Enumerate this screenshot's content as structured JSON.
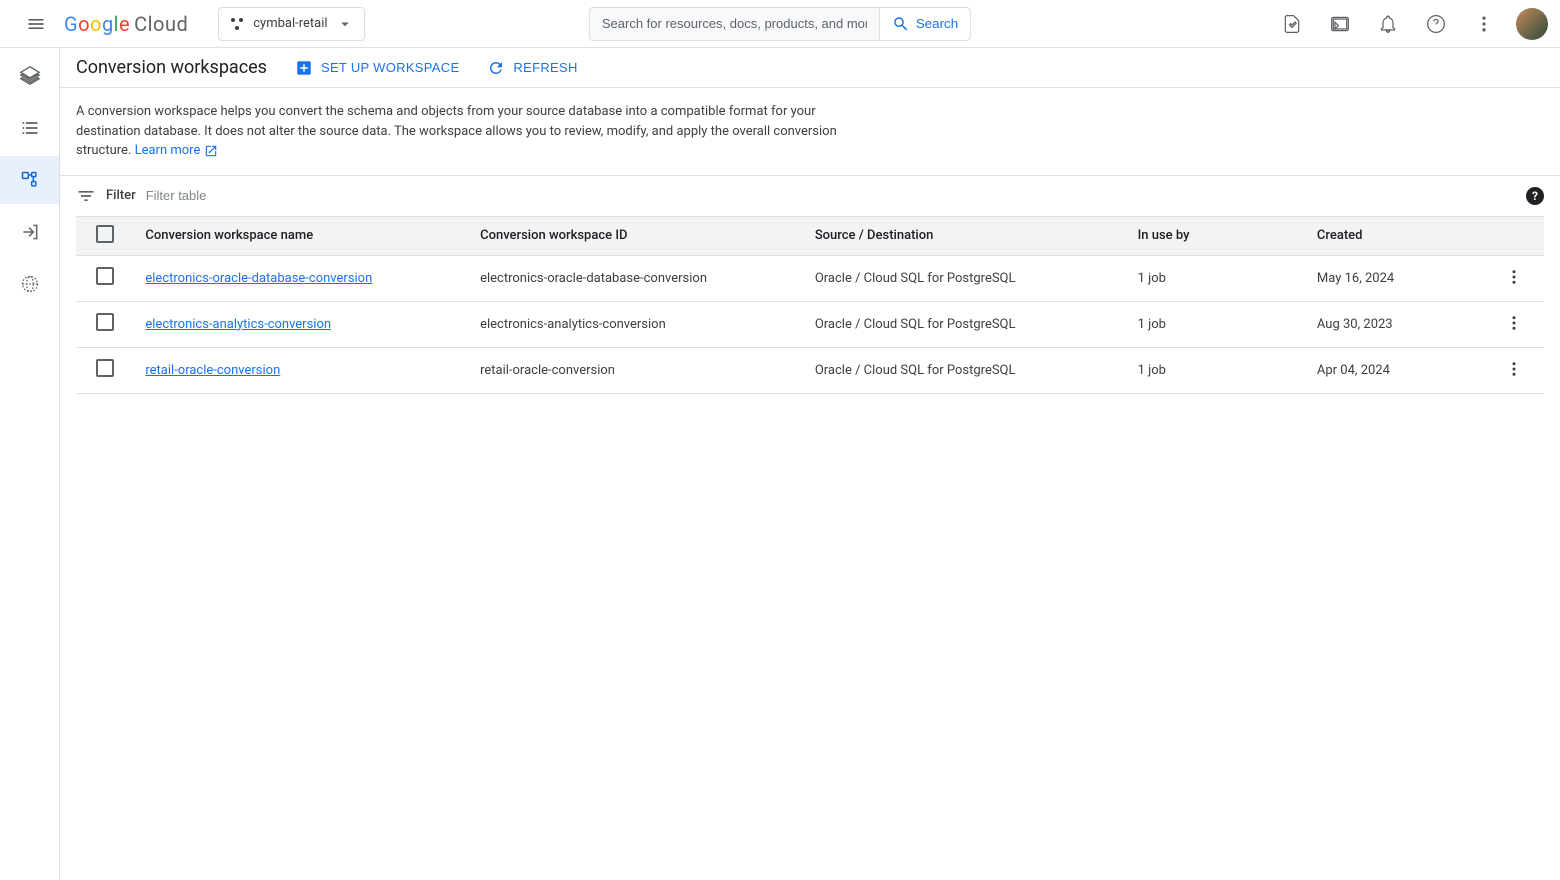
{
  "header": {
    "project": "cymbal-retail",
    "search_placeholder": "Search for resources, docs, products, and more",
    "search_button": "Search"
  },
  "page": {
    "title": "Conversion workspaces",
    "setup_label": "SET UP WORKSPACE",
    "refresh_label": "REFRESH",
    "description_1": "A conversion workspace helps you convert the schema and objects from your source database into a compatible format for your destination database. It does not alter the source data. The workspace allows you to review, modify, and apply the overall conversion structure. ",
    "learn_more": "Learn more"
  },
  "filter": {
    "label": "Filter",
    "placeholder": "Filter table"
  },
  "table": {
    "columns": {
      "name": "Conversion workspace name",
      "id": "Conversion workspace ID",
      "source": "Source / Destination",
      "inuse": "In use by",
      "created": "Created"
    },
    "rows": [
      {
        "name": "electronics-oracle-database-conversion",
        "id": "electronics-oracle-database-conversion",
        "source": "Oracle / Cloud SQL for PostgreSQL",
        "inuse": "1 job",
        "created": "May 16, 2024"
      },
      {
        "name": "electronics-analytics-conversion",
        "id": "electronics-analytics-conversion",
        "source": "Oracle / Cloud SQL for PostgreSQL",
        "inuse": "1 job",
        "created": "Aug 30, 2023"
      },
      {
        "name": "retail-oracle-conversion",
        "id": "retail-oracle-conversion",
        "source": "Oracle / Cloud SQL for PostgreSQL",
        "inuse": "1 job",
        "created": "Apr 04, 2024"
      }
    ]
  }
}
